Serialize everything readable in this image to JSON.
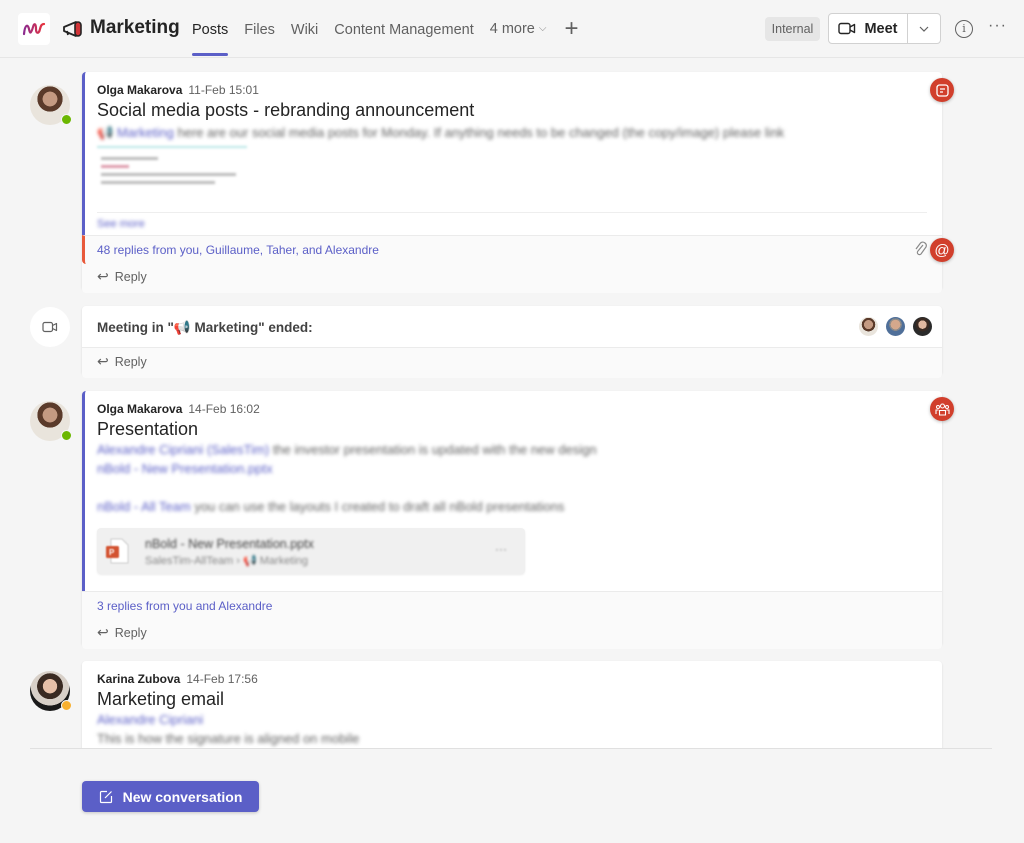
{
  "header": {
    "app_logo": "app-logo-icon",
    "team_icon": "megaphone-icon",
    "team_name": "Marketing",
    "tabs": [
      {
        "label": "Posts",
        "active": true
      },
      {
        "label": "Files",
        "active": false
      },
      {
        "label": "Wiki",
        "active": false
      },
      {
        "label": "Content Management",
        "active": false
      },
      {
        "label": "4 more",
        "active": false
      }
    ],
    "add_tab_icon": "+",
    "sensitivity_label": "Internal",
    "meet_label": "Meet",
    "meet_dropdown_icon": "⌄",
    "info_icon": "i",
    "more_icon": "···"
  },
  "posts": [
    {
      "author": "Olga Makarova",
      "timestamp": "11-Feb 15:01",
      "subject": "Social media posts - rebranding announcement",
      "mention": "Marketing",
      "body": "here are our social media posts for Monday. If anything needs to be changed (the copy/image) please link",
      "see_more": "See more",
      "replies": "48 replies from you, Guillaume, Taher, and Alexandre",
      "reply_label": "Reply",
      "presence": "available",
      "badge_icon": "note-icon",
      "footer_badge_icon": "@",
      "accent_color": "#5b5fc7",
      "reply_accent_color": "#e8593a"
    },
    {
      "type": "meeting",
      "text": "Meeting in \"📢 Marketing\" ended:",
      "reply_label": "Reply",
      "participants": 3
    },
    {
      "author": "Olga Makarova",
      "timestamp": "14-Feb 16:02",
      "subject": "Presentation",
      "line1_mention": "Alexandre Cipriani (SalesTim)",
      "line1_text": "the investor presentation is updated with the new design",
      "line2_link": "nBold - New Presentation.pptx",
      "line3_mention": "nBold - All Team",
      "line3_text": "you can use the layouts I created to draft all nBold presentations",
      "attachment": {
        "name": "nBold - New Presentation.pptx",
        "location": "SalesTim-AllTeam › 📢 Marketing",
        "more": "···"
      },
      "replies": "3 replies from you and Alexandre",
      "reply_label": "Reply",
      "presence": "available",
      "badge_icon": "team-icon"
    },
    {
      "author": "Karina Zubova",
      "timestamp": "14-Feb 17:56",
      "subject": "Marketing email",
      "mention": "Alexandre Cipriani",
      "body": "This is how the signature is aligned on mobile",
      "presence": "away"
    }
  ],
  "compose": {
    "new_conversation_label": "New conversation"
  },
  "colors": {
    "brand": "#5b5fc7",
    "badge": "#d13f2c",
    "available": "#6bb700",
    "away": "#f8b02f"
  }
}
